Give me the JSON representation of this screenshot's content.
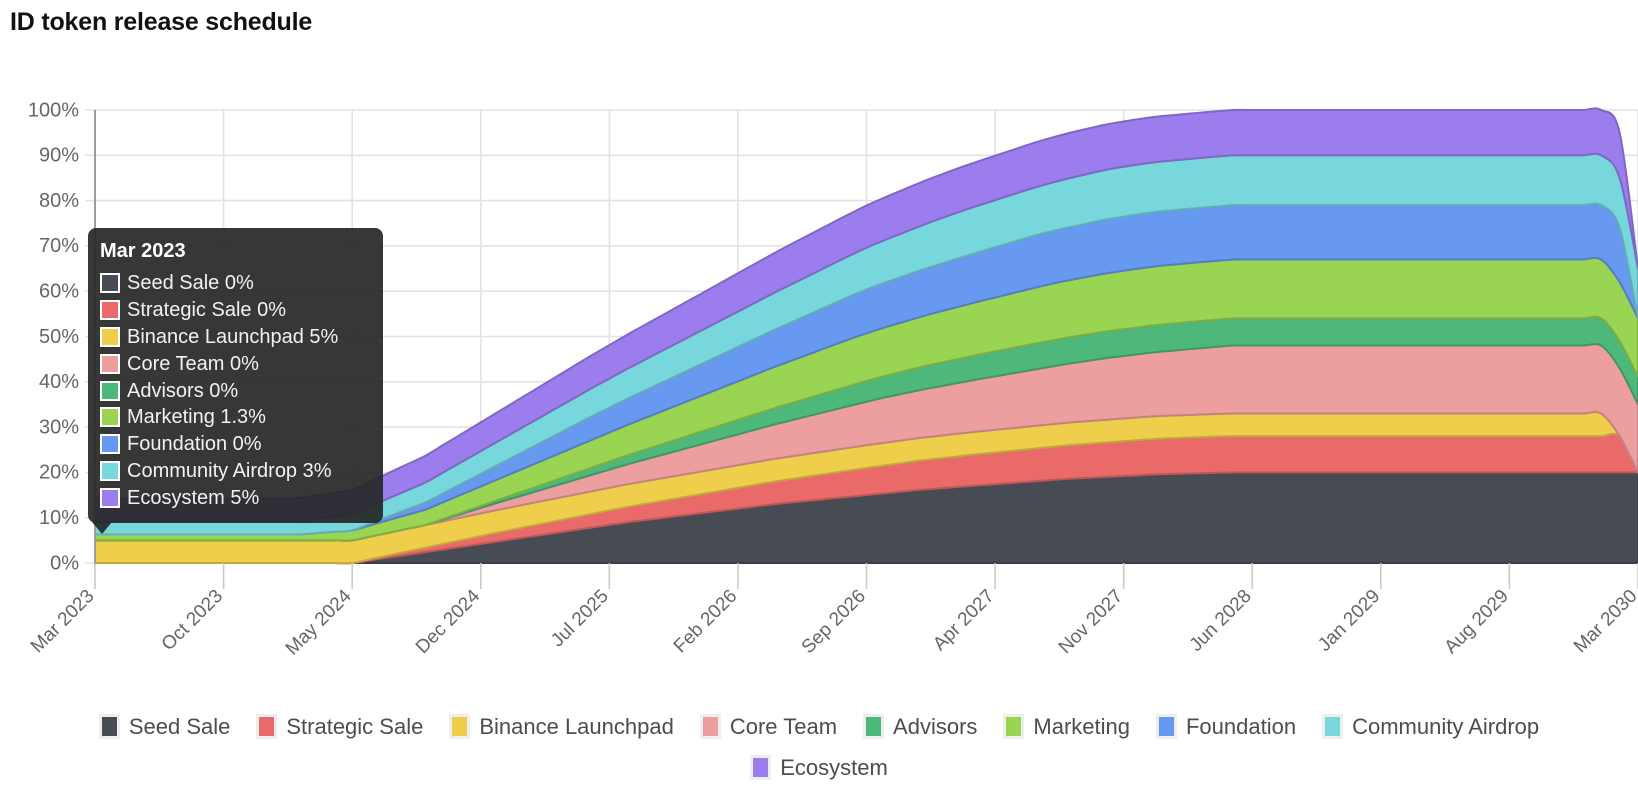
{
  "title": "ID token release schedule",
  "colors": {
    "seed_sale": "#474c54",
    "strategic_sale": "#ea6a6a",
    "binance_launchpad": "#eece4a",
    "core_team": "#ed9f9f",
    "advisors": "#4eb87b",
    "marketing": "#99d453",
    "foundation": "#6699ef",
    "community_airdrop": "#78d6dd",
    "ecosystem": "#9b7ded",
    "grid": "#e3e3e3",
    "axis": "#9b9b9b",
    "tick_text": "#666666",
    "legend_text": "#4d4d4d",
    "tooltip_bg": "#282828"
  },
  "tooltip": {
    "name": "chart-tooltip",
    "title": "Mar 2023",
    "rows": [
      {
        "label": "Seed Sale 0%",
        "color": "#474c54"
      },
      {
        "label": "Strategic Sale 0%",
        "color": "#ea6a6a"
      },
      {
        "label": "Binance Launchpad 5%",
        "color": "#eece4a"
      },
      {
        "label": "Core Team 0%",
        "color": "#ed9f9f"
      },
      {
        "label": "Advisors 0%",
        "color": "#4eb87b"
      },
      {
        "label": "Marketing 1.3%",
        "color": "#99d453"
      },
      {
        "label": "Foundation 0%",
        "color": "#6699ef"
      },
      {
        "label": "Community Airdrop 3%",
        "color": "#78d6dd"
      },
      {
        "label": "Ecosystem 5%",
        "color": "#9b7ded"
      }
    ]
  },
  "legend": {
    "row1": [
      {
        "label": "Seed Sale",
        "color": "#474c54"
      },
      {
        "label": "Strategic Sale",
        "color": "#ea6a6a"
      },
      {
        "label": "Binance Launchpad",
        "color": "#eece4a"
      },
      {
        "label": "Core Team",
        "color": "#ed9f9f"
      },
      {
        "label": "Advisors",
        "color": "#4eb87b"
      },
      {
        "label": "Marketing",
        "color": "#99d453"
      },
      {
        "label": "Foundation",
        "color": "#6699ef"
      },
      {
        "label": "Community Airdrop",
        "color": "#78d6dd"
      }
    ],
    "row2": [
      {
        "label": "Ecosystem",
        "color": "#9b7ded"
      }
    ]
  },
  "chart_data": {
    "type": "area",
    "stacked": true,
    "title": "ID token release schedule",
    "xlabel": "",
    "ylabel": "",
    "ylim": [
      0,
      100
    ],
    "ytick_labels": [
      "0%",
      "10%",
      "20%",
      "30%",
      "40%",
      "50%",
      "60%",
      "70%",
      "80%",
      "90%",
      "100%"
    ],
    "ytick_values": [
      0,
      10,
      20,
      30,
      40,
      50,
      60,
      70,
      80,
      90,
      100
    ],
    "xtick_labels": [
      "Mar 2023",
      "Oct 2023",
      "May 2024",
      "Dec 2024",
      "Jul 2025",
      "Feb 2026",
      "Sep 2026",
      "Apr 2027",
      "Nov 2027",
      "Jun 2028",
      "Jan 2029",
      "Aug 2029",
      "Mar 2030"
    ],
    "grid": true,
    "legend_position": "bottom",
    "x_months": [
      "Mar 2023",
      "Apr 2023",
      "May 2023",
      "Jun 2023",
      "Jul 2023",
      "Aug 2023",
      "Sep 2023",
      "Oct 2023",
      "Nov 2023",
      "Dec 2023",
      "Jan 2024",
      "Feb 2024",
      "Mar 2024",
      "Apr 2024",
      "May 2024",
      "Jun 2024",
      "Jul 2024",
      "Aug 2024",
      "Sep 2024",
      "Oct 2024",
      "Nov 2024",
      "Dec 2024",
      "Jan 2025",
      "Feb 2025",
      "Mar 2025",
      "Apr 2025",
      "May 2025",
      "Jun 2025",
      "Jul 2025",
      "Aug 2025",
      "Sep 2025",
      "Oct 2025",
      "Nov 2025",
      "Dec 2025",
      "Jan 2026",
      "Feb 2026",
      "Mar 2026",
      "Apr 2026",
      "May 2026",
      "Jun 2026",
      "Jul 2026",
      "Aug 2026",
      "Sep 2026",
      "Oct 2026",
      "Nov 2026",
      "Dec 2026",
      "Jan 2027",
      "Feb 2027",
      "Mar 2027",
      "Apr 2027",
      "May 2027",
      "Jun 2027",
      "Jul 2027",
      "Aug 2027",
      "Sep 2027",
      "Oct 2027",
      "Nov 2027",
      "Dec 2027",
      "Jan 2028",
      "Feb 2028",
      "Mar 2028",
      "Apr 2028",
      "May 2028",
      "Jun 2028",
      "Jul 2028",
      "Aug 2028",
      "Sep 2028",
      "Oct 2028",
      "Nov 2028",
      "Dec 2028",
      "Jan 2029",
      "Feb 2029",
      "Mar 2029",
      "Apr 2029",
      "May 2029",
      "Jun 2029",
      "Jul 2029",
      "Aug 2029",
      "Sep 2029",
      "Oct 2029",
      "Nov 2029",
      "Dec 2029",
      "Jan 2030",
      "Feb 2030",
      "Mar 2030"
    ],
    "series": [
      {
        "name": "Seed Sale",
        "color": "#474c54",
        "final_pct": 20,
        "values": [
          0,
          0,
          0,
          0,
          0,
          0,
          0,
          0,
          0,
          0,
          0,
          0,
          0,
          0,
          0,
          0.6,
          1.2,
          1.8,
          2.4,
          3.0,
          3.6,
          4.2,
          4.8,
          5.4,
          6.0,
          6.6,
          7.2,
          7.8,
          8.4,
          9.0,
          9.5,
          10.0,
          10.5,
          11.0,
          11.5,
          12.0,
          12.5,
          13.0,
          13.4,
          13.8,
          14.2,
          14.6,
          15.0,
          15.4,
          15.8,
          16.2,
          16.5,
          16.8,
          17.1,
          17.4,
          17.7,
          18.0,
          18.3,
          18.6,
          18.8,
          19.0,
          19.2,
          19.4,
          19.6,
          19.7,
          19.8,
          19.9,
          20,
          20,
          20,
          20,
          20,
          20,
          20,
          20,
          20,
          20,
          20,
          20,
          20,
          20,
          20,
          20,
          20,
          20,
          20,
          20,
          20,
          20,
          20
        ]
      },
      {
        "name": "Strategic Sale",
        "color": "#ea6a6a",
        "final_pct": 8,
        "values": [
          0,
          0,
          0,
          0,
          0,
          0,
          0,
          0,
          0,
          0,
          0,
          0,
          0,
          0,
          0,
          0.25,
          0.5,
          0.75,
          1.0,
          1.25,
          1.5,
          1.75,
          2.0,
          2.2,
          2.4,
          2.6,
          2.8,
          3.0,
          3.2,
          3.4,
          3.6,
          3.8,
          4.0,
          4.2,
          4.4,
          4.6,
          4.8,
          5.0,
          5.2,
          5.4,
          5.6,
          5.8,
          6.0,
          6.15,
          6.3,
          6.45,
          6.6,
          6.75,
          6.9,
          7.0,
          7.1,
          7.2,
          7.3,
          7.4,
          7.5,
          7.6,
          7.7,
          7.8,
          7.85,
          7.9,
          7.95,
          8,
          8,
          8,
          8,
          8,
          8,
          8,
          8,
          8,
          8,
          8,
          8,
          8,
          8,
          8,
          8,
          8,
          8,
          8,
          8,
          8,
          8,
          8
        ]
      },
      {
        "name": "Binance Launchpad",
        "color": "#eece4a",
        "final_pct": 5,
        "values": [
          5,
          5,
          5,
          5,
          5,
          5,
          5,
          5,
          5,
          5,
          5,
          5,
          5,
          5,
          5,
          5,
          5,
          5,
          5,
          5,
          5,
          5,
          5,
          5,
          5,
          5,
          5,
          5,
          5,
          5,
          5,
          5,
          5,
          5,
          5,
          5,
          5,
          5,
          5,
          5,
          5,
          5,
          5,
          5,
          5,
          5,
          5,
          5,
          5,
          5,
          5,
          5,
          5,
          5,
          5,
          5,
          5,
          5,
          5,
          5,
          5,
          5,
          5,
          5,
          5,
          5,
          5,
          5,
          5,
          5,
          5,
          5,
          5,
          5,
          5,
          5,
          5,
          5,
          5,
          5,
          5,
          5,
          5
        ]
      },
      {
        "name": "Core Team",
        "color": "#ed9f9f",
        "final_pct": 15,
        "values": [
          0,
          0,
          0,
          0,
          0,
          0,
          0,
          0,
          0,
          0,
          0,
          0,
          0,
          0,
          0,
          0,
          0,
          0,
          0,
          0.4,
          0.8,
          1.2,
          1.6,
          2.0,
          2.4,
          2.8,
          3.2,
          3.6,
          4.0,
          4.4,
          4.8,
          5.2,
          5.6,
          6.0,
          6.4,
          6.8,
          7.2,
          7.6,
          8.0,
          8.4,
          8.8,
          9.2,
          9.6,
          10.0,
          10.3,
          10.6,
          10.9,
          11.2,
          11.5,
          11.8,
          12.1,
          12.4,
          12.7,
          13.0,
          13.3,
          13.6,
          13.8,
          14.0,
          14.2,
          14.4,
          14.6,
          14.8,
          15,
          15,
          15,
          15,
          15,
          15,
          15,
          15,
          15,
          15,
          15,
          15,
          15,
          15,
          15,
          15,
          15,
          15,
          15,
          15,
          15,
          15,
          15
        ]
      },
      {
        "name": "Advisors",
        "color": "#4eb87b",
        "final_pct": 6,
        "values": [
          0,
          0,
          0,
          0,
          0,
          0,
          0,
          0,
          0,
          0,
          0,
          0,
          0,
          0,
          0,
          0,
          0,
          0,
          0,
          0.15,
          0.3,
          0.45,
          0.6,
          0.8,
          1.0,
          1.2,
          1.4,
          1.6,
          1.8,
          2.0,
          2.2,
          2.4,
          2.6,
          2.8,
          3.0,
          3.2,
          3.4,
          3.6,
          3.8,
          4.0,
          4.2,
          4.4,
          4.6,
          4.75,
          4.9,
          5.05,
          5.2,
          5.3,
          5.4,
          5.5,
          5.6,
          5.7,
          5.75,
          5.8,
          5.85,
          5.9,
          5.92,
          5.94,
          5.96,
          5.98,
          6,
          6,
          6,
          6,
          6,
          6,
          6,
          6,
          6,
          6,
          6,
          6,
          6,
          6,
          6,
          6,
          6,
          6,
          6,
          6,
          6,
          6,
          6,
          6,
          6
        ]
      },
      {
        "name": "Marketing",
        "color": "#99d453",
        "final_pct": 13,
        "values": [
          1.3,
          1.3,
          1.3,
          1.3,
          1.3,
          1.3,
          1.3,
          1.3,
          1.3,
          1.3,
          1.3,
          1.3,
          1.6,
          1.9,
          2.2,
          2.5,
          2.8,
          3.1,
          3.4,
          3.7,
          4.0,
          4.3,
          4.6,
          4.9,
          5.2,
          5.5,
          5.8,
          6.1,
          6.4,
          6.7,
          7.0,
          7.3,
          7.6,
          7.9,
          8.2,
          8.5,
          8.8,
          9.1,
          9.4,
          9.7,
          10.0,
          10.3,
          10.5,
          10.7,
          10.9,
          11.1,
          11.3,
          11.5,
          11.7,
          11.9,
          12.1,
          12.3,
          12.5,
          12.6,
          12.7,
          12.8,
          12.9,
          12.95,
          13,
          13,
          13,
          13,
          13,
          13,
          13,
          13,
          13,
          13,
          13,
          13,
          13,
          13,
          13,
          13,
          13,
          13,
          13,
          13,
          13,
          13,
          13,
          13,
          13,
          13,
          13
        ]
      },
      {
        "name": "Foundation",
        "color": "#6699ef",
        "final_pct": 12,
        "values": [
          0,
          0,
          0,
          0,
          0,
          0,
          0,
          0,
          0,
          0,
          0,
          0,
          0,
          0,
          0,
          0.4,
          0.8,
          1.2,
          1.6,
          2.0,
          2.4,
          2.8,
          3.2,
          3.6,
          4.0,
          4.4,
          4.8,
          5.2,
          5.5,
          5.8,
          6.1,
          6.4,
          6.7,
          7.0,
          7.3,
          7.6,
          7.9,
          8.2,
          8.5,
          8.8,
          9.1,
          9.4,
          9.7,
          9.9,
          10.1,
          10.3,
          10.5,
          10.7,
          10.9,
          11.1,
          11.3,
          11.5,
          11.6,
          11.7,
          11.8,
          11.9,
          11.95,
          12,
          12,
          12,
          12,
          12,
          12,
          12,
          12,
          12,
          12,
          12,
          12,
          12,
          12,
          12,
          12,
          12,
          12,
          12,
          12,
          12,
          12,
          12,
          12,
          12,
          12,
          12
        ]
      },
      {
        "name": "Community Airdrop",
        "color": "#78d6dd",
        "final_pct": 11,
        "values": [
          3,
          3,
          3,
          3,
          3,
          3,
          3,
          3,
          3,
          3,
          3,
          3,
          3.2,
          3.4,
          3.6,
          3.8,
          4.0,
          4.2,
          4.4,
          4.6,
          4.8,
          5.0,
          5.2,
          5.4,
          5.6,
          5.8,
          6.0,
          6.2,
          6.4,
          6.6,
          6.8,
          7.0,
          7.2,
          7.4,
          7.6,
          7.8,
          8.0,
          8.2,
          8.4,
          8.6,
          8.8,
          9.0,
          9.2,
          9.4,
          9.6,
          9.8,
          10.0,
          10.2,
          10.3,
          10.4,
          10.5,
          10.6,
          10.7,
          10.8,
          10.9,
          10.95,
          11,
          11,
          11,
          11,
          11,
          11,
          11,
          11,
          11,
          11,
          11,
          11,
          11,
          11,
          11,
          11,
          11,
          11,
          11,
          11,
          11,
          11,
          11,
          11,
          11,
          11,
          11,
          11,
          11
        ]
      },
      {
        "name": "Ecosystem",
        "color": "#9b7ded",
        "final_pct": 10,
        "values": [
          5,
          5,
          5,
          5,
          5,
          5,
          5,
          5,
          5,
          5,
          5,
          5,
          5.1,
          5.2,
          5.3,
          5.45,
          5.6,
          5.75,
          5.9,
          6.05,
          6.2,
          6.35,
          6.5,
          6.65,
          6.8,
          6.95,
          7.1,
          7.25,
          7.4,
          7.55,
          7.7,
          7.85,
          8.0,
          8.15,
          8.3,
          8.45,
          8.6,
          8.75,
          8.9,
          9.0,
          9.1,
          9.2,
          9.3,
          9.4,
          9.5,
          9.6,
          9.65,
          9.7,
          9.75,
          9.8,
          9.85,
          9.9,
          9.95,
          10,
          10,
          10,
          10,
          10,
          10,
          10,
          10,
          10,
          10,
          10,
          10,
          10,
          10,
          10,
          10,
          10,
          10,
          10,
          10,
          10,
          10,
          10,
          10,
          10,
          10,
          10,
          10,
          10,
          10,
          10
        ]
      }
    ]
  }
}
